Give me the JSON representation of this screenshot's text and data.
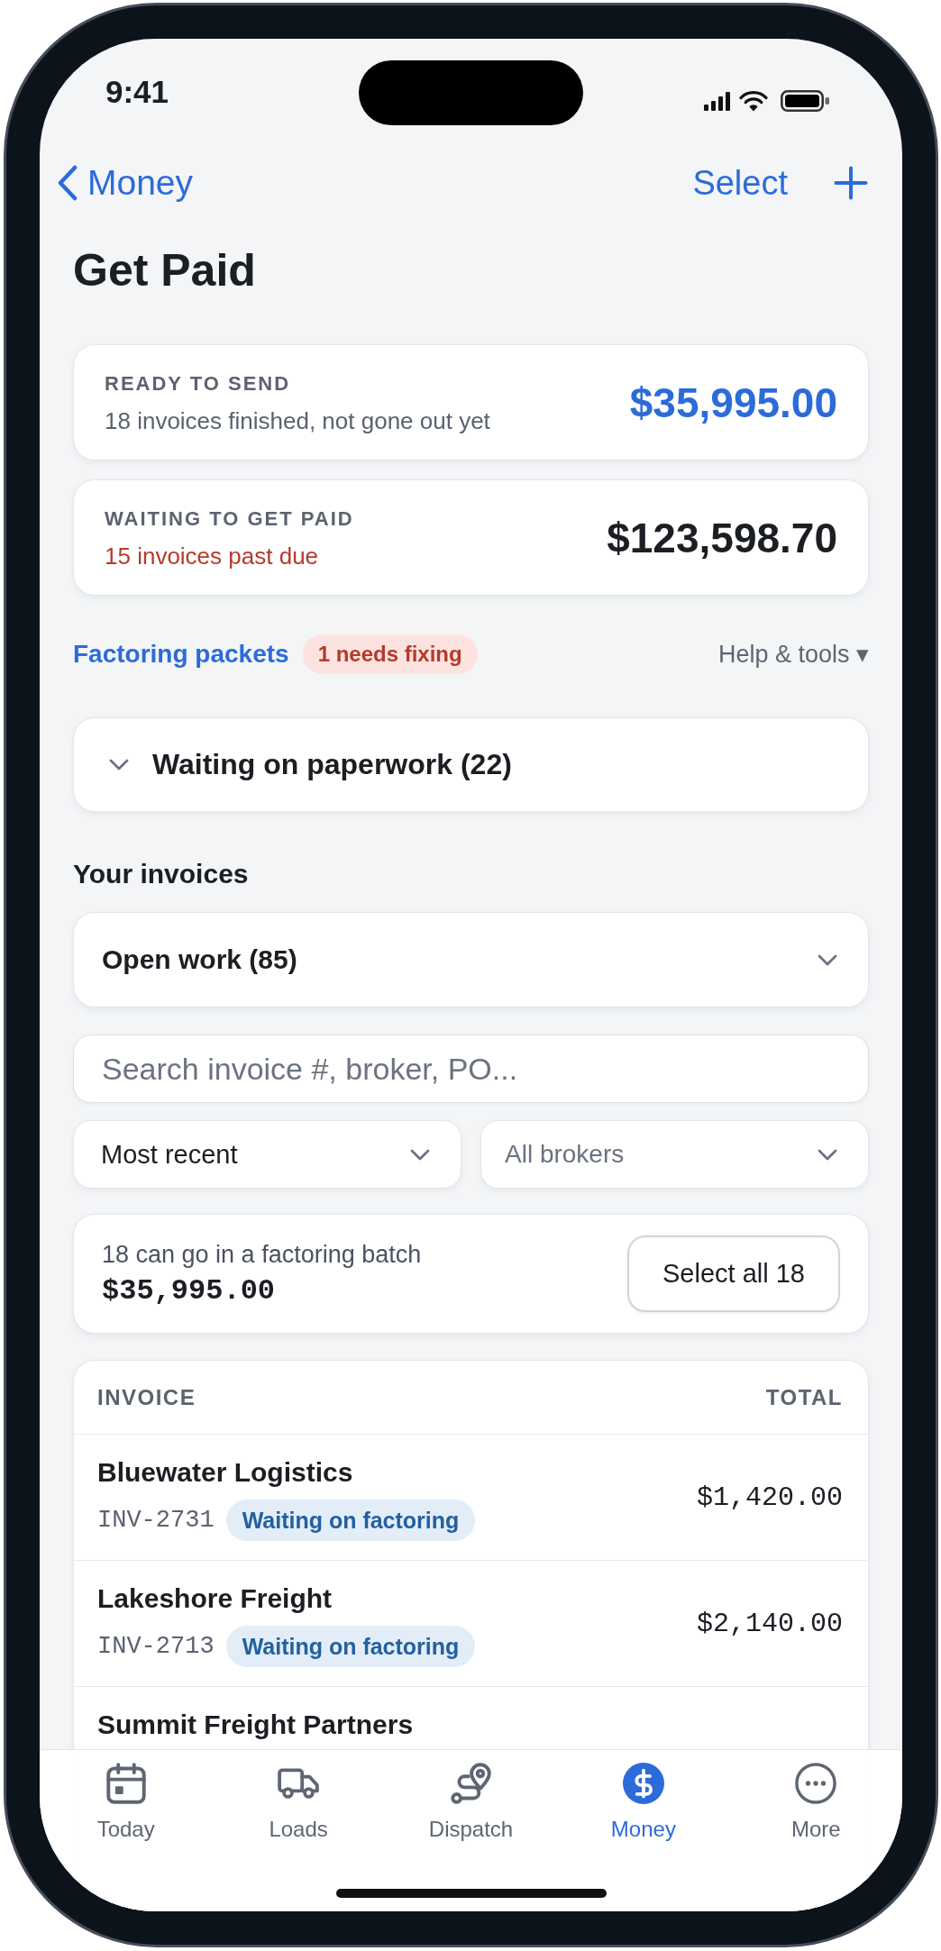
{
  "status_bar": {
    "time": "9:41"
  },
  "nav": {
    "back": "Money",
    "action": "Select"
  },
  "title": "Get Paid",
  "summary_cards": [
    {
      "label": "READY TO SEND",
      "note": "18 invoices finished, not gone out yet",
      "amount": "$35,995.00",
      "highlighted": true,
      "past_due": false
    },
    {
      "label": "WAITING TO GET PAID",
      "note": "15 invoices past due",
      "amount": "$123,598.70",
      "highlighted": false,
      "past_due": true
    }
  ],
  "packets": {
    "link": "Factoring packets",
    "alert": "1 needs fixing",
    "menu": "Help & tools ▾"
  },
  "paperwork_group": {
    "label": "Waiting on paperwork (22)"
  },
  "invoices": {
    "heading": "Your invoices",
    "view": "Open work (85)",
    "search": {
      "placeholder": "Search invoice #, broker, PO..."
    },
    "filters": [
      {
        "value": "Most recent"
      },
      {
        "placeholder": "All brokers"
      }
    ]
  },
  "batch": {
    "note": "18 can go in a factoring batch",
    "amount": "$35,995.00",
    "button": "Select all 18"
  },
  "table": {
    "columns": [
      "INVOICE",
      "TOTAL"
    ],
    "rows": [
      {
        "broker": "Bluewater Logistics",
        "number": "INV-2731",
        "status": "Waiting on factoring",
        "total": "$1,420.00"
      },
      {
        "broker": "Lakeshore Freight",
        "number": "INV-2713",
        "status": "Waiting on factoring",
        "total": "$2,140.00"
      },
      {
        "broker": "Summit Freight Partners"
      }
    ]
  },
  "tab_bar": [
    {
      "label": "Today",
      "kind": "today",
      "selected": false
    },
    {
      "label": "Loads",
      "kind": "loads",
      "selected": false
    },
    {
      "label": "Dispatch",
      "kind": "dispatch",
      "selected": false
    },
    {
      "label": "Money",
      "kind": "money",
      "selected": true
    },
    {
      "label": "More",
      "kind": "more",
      "selected": false
    }
  ]
}
